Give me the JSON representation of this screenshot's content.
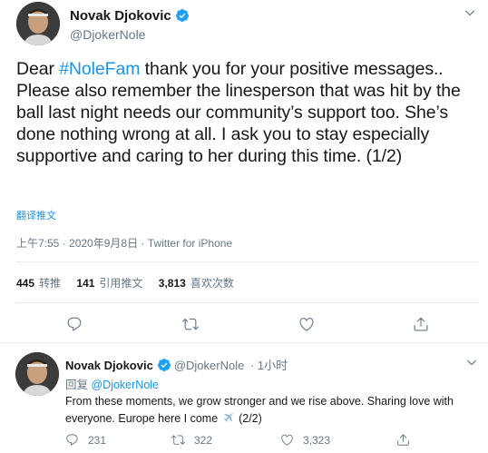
{
  "main_tweet": {
    "author_name": "Novak Djokovic",
    "author_handle": "@DjokerNole",
    "text_before_hashtag": "Dear ",
    "hashtag": "#NoleFam",
    "text_after_hashtag": " thank you for your positive messages.. Please also remember the linesperson that was hit by the ball last night needs our community’s support too. She’s done nothing wrong at all. I ask you to stay especially supportive and caring to her during this time. (1/2)",
    "translate_label": "翻译推文",
    "timestamp": "上午7:55 · 2020年9月8日",
    "separator": " · ",
    "source": "Twitter for iPhone",
    "stats": {
      "retweets_count": "445",
      "retweets_label": "转推",
      "quotes_count": "141",
      "quotes_label": "引用推文",
      "likes_count": "3,813",
      "likes_label": "喜欢次数"
    }
  },
  "reply_tweet": {
    "author_name": "Novak Djokovic",
    "author_handle": "@DjokerNole",
    "time_ago": "· 1小时",
    "reply_prefix": "回复 ",
    "reply_mention": "@DjokerNole",
    "text_part1": "From these moments, we grow stronger and we rise above. Sharing love with everyone. Europe here I come ",
    "text_part2": " (2/2)",
    "counts": {
      "replies": "231",
      "retweets": "322",
      "likes": "3,323"
    }
  },
  "colors": {
    "accent": "#1b95e0",
    "verified": "#1da1f2",
    "secondary_text": "#657786",
    "border": "#e6ecf0"
  },
  "icons": [
    "verified-badge-icon",
    "chevron-down-icon",
    "reply-icon",
    "retweet-icon",
    "like-icon",
    "share-icon",
    "airplane-icon"
  ]
}
